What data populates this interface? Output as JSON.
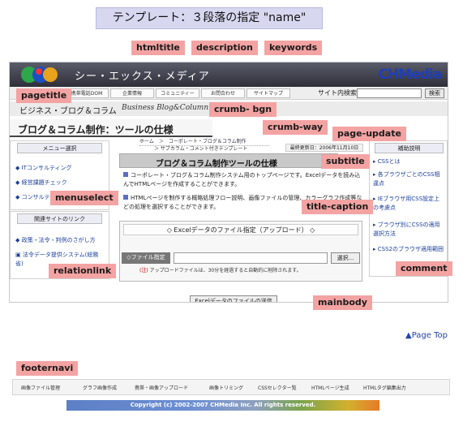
{
  "banner": {
    "title": "テンプレート：３段落の指定 \"name\""
  },
  "tags": {
    "htmltitle": "htmltitle",
    "description": "description",
    "keywords": "keywords",
    "pagetitle": "pagetitle",
    "crumb_bgn": "crumb- bgn",
    "crumb_way": "crumb-way",
    "page_update": "page-update",
    "subtitle": "subtitle",
    "menuselect": "menuselect",
    "title_caption": "title-caption",
    "relationlink": "relationlink",
    "comment": "comment",
    "mainbody": "mainbody",
    "footernavi": "footernavi"
  },
  "header": {
    "site_name": "シー・エックス・メディア",
    "brand": "CHMedia"
  },
  "navbar": {
    "items": [
      "携帯電話DOM",
      "企業情報",
      "コミュニティー",
      "お問合わせ",
      "サイトマップ"
    ],
    "search_label": "サイト内検索",
    "search_button": "検索"
  },
  "pagetitle": {
    "text": "ビジネス・ブログ＆コラム",
    "sub": "Business Blog&Column"
  },
  "crumb": {
    "bgn": "ブログ＆コラム制作：ツールの仕様",
    "way": "ホーム　＞　コーポレート・ブログ＆コラム制作",
    "way_sub": "＞ サブカラム・コメント付きテンプレート",
    "update": "最終更新日：2006年11月10日"
  },
  "menu": {
    "heading": "メニュー選択",
    "items": [
      "ITコンサルティング",
      "経営課題チェック",
      "コンサルテ"
    ]
  },
  "relation": {
    "heading": "関連サイトのリンク",
    "items": [
      "政策・法令・判例のさがし方",
      "法令データ提供システム(総務省)"
    ]
  },
  "subtitle": {
    "text": "ブログ＆コラム制作ツールの仕様"
  },
  "captions": [
    "コーポレート・ブログ＆コラム制作システム用のトップページです。Excelデータを読み込んでHTMLページを作成することができます。",
    "HTMLページを制作する概略処理フロー説明、画像ファイルの管理、カラーグラフ作成等などの処理を選択することができます。"
  ],
  "upload": {
    "heading": "◇ Excelデータのファイル指定（アップロード） ◇",
    "file_label": "◇ファイル指定",
    "browse_button": "選択...",
    "note_mark": "(注)",
    "note": "アップロードファイルは、30分を経過すると自動的に削除されます。",
    "send_button": "Excelデータのファイルの送信"
  },
  "comment": {
    "heading": "補助説明",
    "items": [
      "CSSとは",
      "各ブラウザごとのCSS相違点",
      "IEブラウザ用CSS設定上の考慮点",
      "ブラウザ別にCSSの適用選択方法",
      "CSS2のブラウザ適用範囲"
    ]
  },
  "pagetop": "Page Top",
  "footer": {
    "items": [
      "画像ファイル管理",
      "グラフ画像作成",
      "携帯・画像アップロード",
      "画像トリミング",
      "CSSセレクター覧",
      "HTMLページ生成",
      "HTMLタグ編集出力"
    ],
    "copyright": "Copyright (c) 2002-2007 CHMedia Inc. All rights reserved."
  },
  "colors": {
    "tag": "#f4a3a3",
    "banner": "#d7d7f0",
    "link": "#1a3f99"
  }
}
